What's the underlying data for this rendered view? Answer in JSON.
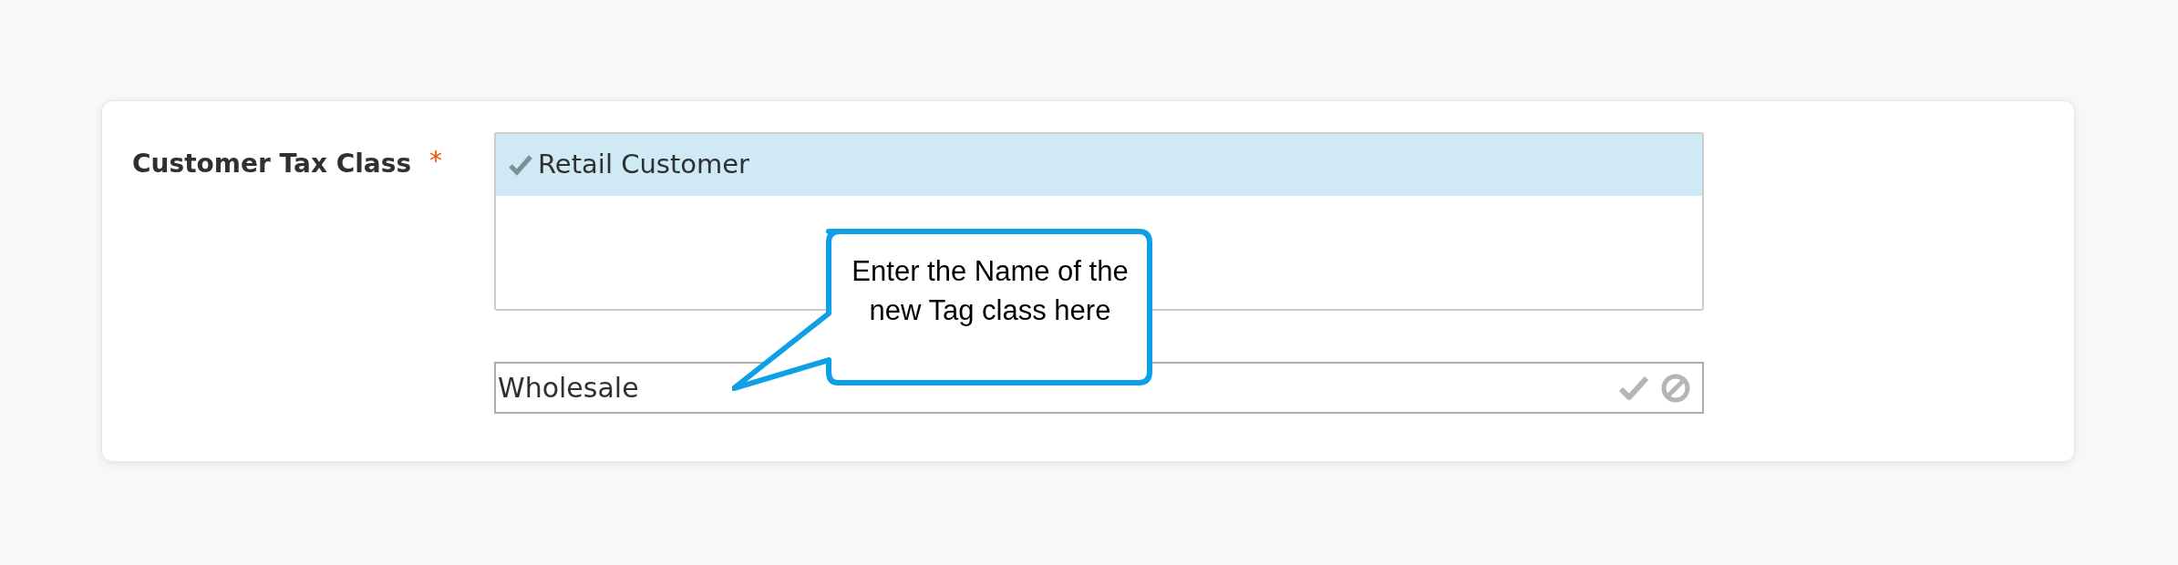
{
  "field": {
    "label": "Customer Tax Class",
    "required_mark": "*",
    "options": [
      {
        "label": "Retail Customer",
        "selected": true
      }
    ],
    "new_value": "Wholesale"
  },
  "callout": {
    "text": "Enter the Name of the new Tag class here"
  }
}
